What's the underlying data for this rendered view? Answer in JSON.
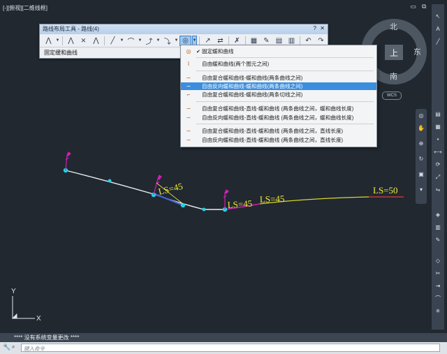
{
  "viewport": {
    "label": "[-][俯视][二维线框]",
    "controls": {
      "minimize": "▭",
      "restore": "⧉",
      "close": "✕"
    }
  },
  "toolbar_window": {
    "title": "路线布局工具 - 路线(4)",
    "close_glyph": "✕",
    "help_glyph": "?",
    "status_text": "固定缓和曲线"
  },
  "menu": {
    "items": [
      {
        "label": "固定缓和曲线",
        "checked": true,
        "selected": false
      },
      {
        "label": "自由缓和曲线(两个图元之间)",
        "checked": false,
        "selected": false
      },
      {
        "label": "自由复合缓和曲线-缓和曲线(两条曲线之间)",
        "checked": false,
        "selected": false
      },
      {
        "label": "自由反向缓和曲线-缓和曲线(两条曲线之间)",
        "checked": false,
        "selected": true
      },
      {
        "label": "自由复合缓和曲线-缓和曲线(两条切线之间)",
        "checked": false,
        "selected": false
      },
      {
        "label": "自由复合缓和曲线-直线-缓和曲线 (两条曲线之间，缓和曲线长度)",
        "checked": false,
        "selected": false
      },
      {
        "label": "自由反向缓和曲线-直线-缓和曲线 (两条曲线之间，缓和曲线长度)",
        "checked": false,
        "selected": false
      },
      {
        "label": "自由复合缓和曲线-直线-缓和曲线 (两条曲线之间，直线长度)",
        "checked": false,
        "selected": false
      },
      {
        "label": "自由反向缓和曲线-直线-缓和曲线 (两条曲线之间，直线长度)",
        "checked": false,
        "selected": false
      }
    ]
  },
  "compass": {
    "north": "北",
    "south": "南",
    "east": "东",
    "top": "上",
    "wcs": "WCS"
  },
  "drawing": {
    "labels": [
      "LS=45",
      "LS=45",
      "LS=45",
      "LS=50"
    ],
    "colors": {
      "curve": "#e8eef2",
      "blue_segment": "#3f67d8",
      "magenta": "#d01fb4",
      "yellow": "#d6d92a",
      "red": "#e03a3a",
      "grip": "#22d3e6",
      "label_yellow": "#f0ee3a"
    }
  },
  "ucs": {
    "y": "Y",
    "x": "X"
  },
  "command": {
    "history": "****  没有系统变量更改  ****",
    "placeholder": "键入命令"
  }
}
